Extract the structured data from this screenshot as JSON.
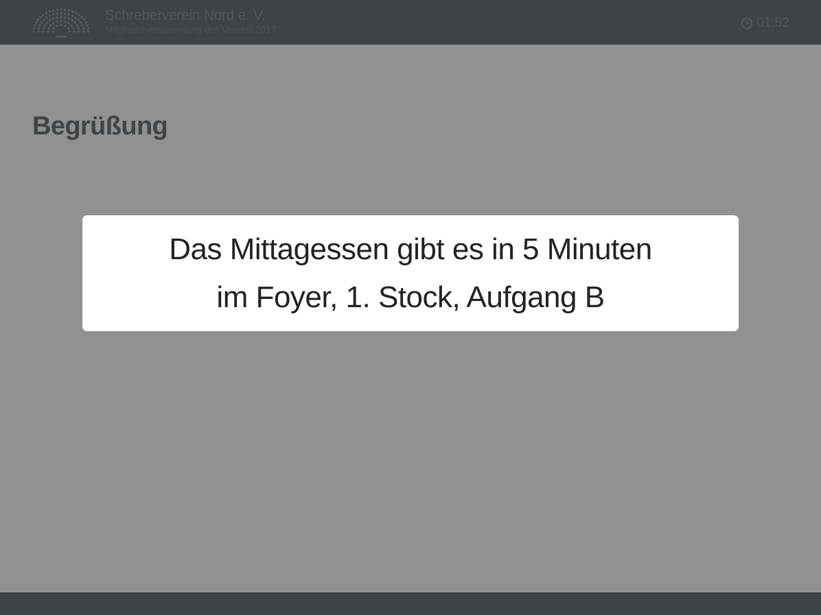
{
  "header": {
    "org_title": "Schreberverein Nord e. V.",
    "event_subtitle": "Mitgliederversammlung des Vereins 2017",
    "clock_time": "01:52",
    "clock_icon": "clock-icon",
    "logo_icon": "parliament-seats-logo"
  },
  "main": {
    "agenda_title": "Begrüßung"
  },
  "message": {
    "line1": "Das Mittagessen gibt es in 5 Minuten",
    "line2": "im Foyer, 1. Stock, Aufgang B"
  },
  "colors": {
    "bar": "#6b777d",
    "overlay": "rgba(0,0,0,0.43)",
    "message_bg": "#ffffff",
    "message_text": "#222222"
  }
}
